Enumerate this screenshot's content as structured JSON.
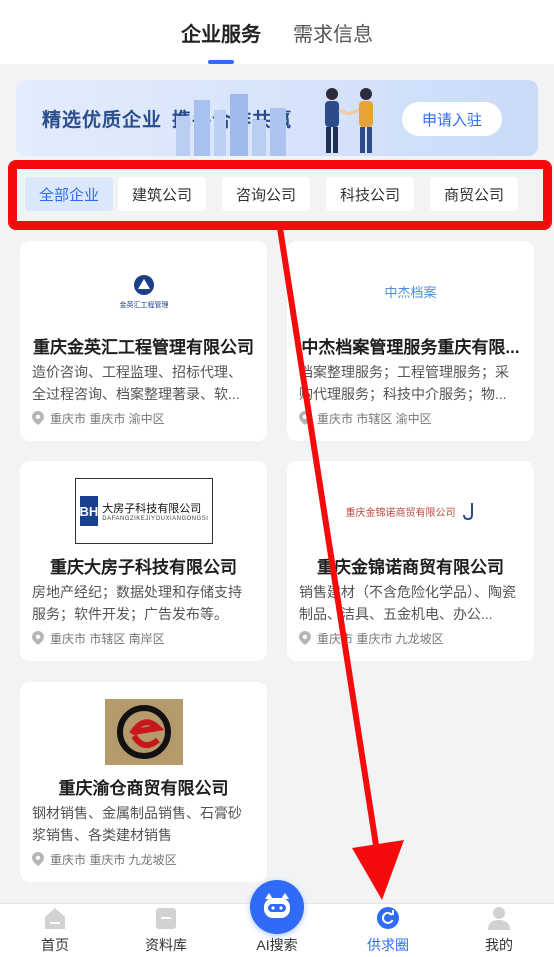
{
  "top_tabs": [
    "企业服务",
    "需求信息"
  ],
  "banner": {
    "slogan_1": "精选优质企业",
    "slogan_2": "携手合作共赢",
    "join_label": "申请入驻"
  },
  "categories": [
    "全部企业",
    "建筑公司",
    "咨询公司",
    "科技公司",
    "商贸公司"
  ],
  "companies": [
    {
      "name": "重庆金英汇工程管理有限公司",
      "desc": "造价咨询、工程监理、招标代理、全过程咨询、档案整理著录、软...",
      "location": "重庆市 重庆市 渝中区",
      "logo_text": "金英汇工程管理"
    },
    {
      "name": "中杰档案管理服务重庆有限...",
      "desc": "档案整理服务；工程管理服务；采购代理服务；科技中介服务；物...",
      "location": "重庆市 市辖区 渝中区",
      "logo_text": "中杰档案"
    },
    {
      "name": "重庆大房子科技有限公司",
      "desc": "房地产经纪；数据处理和存储支持服务；软件开发；广告发布等。",
      "location": "重庆市 市辖区 南岸区",
      "logo_text": "大房子科技有限公司",
      "logo_subtext": "DAFANGZIKEJIYOUXIANGONGSI",
      "logo_mark": "BH"
    },
    {
      "name": "重庆金锦诺商贸有限公司",
      "desc": "销售建材（不含危险化学品）、陶瓷制品、洁具、五金机电、办公...",
      "location": "重庆市 重庆市 九龙坡区",
      "logo_text": "重庆金锦诺商贸有限公司"
    },
    {
      "name": "重庆渝仓商贸有限公司",
      "desc": "钢材销售、金属制品销售、石膏砂浆销售、各类建材销售",
      "location": "重庆市 重庆市 九龙坡区"
    }
  ],
  "bottom_nav": [
    "首页",
    "资料库",
    "AI搜索",
    "供求圈",
    "我的"
  ],
  "colors": {
    "accent": "#2f6bf6",
    "annotation_red": "#f50b0b"
  }
}
